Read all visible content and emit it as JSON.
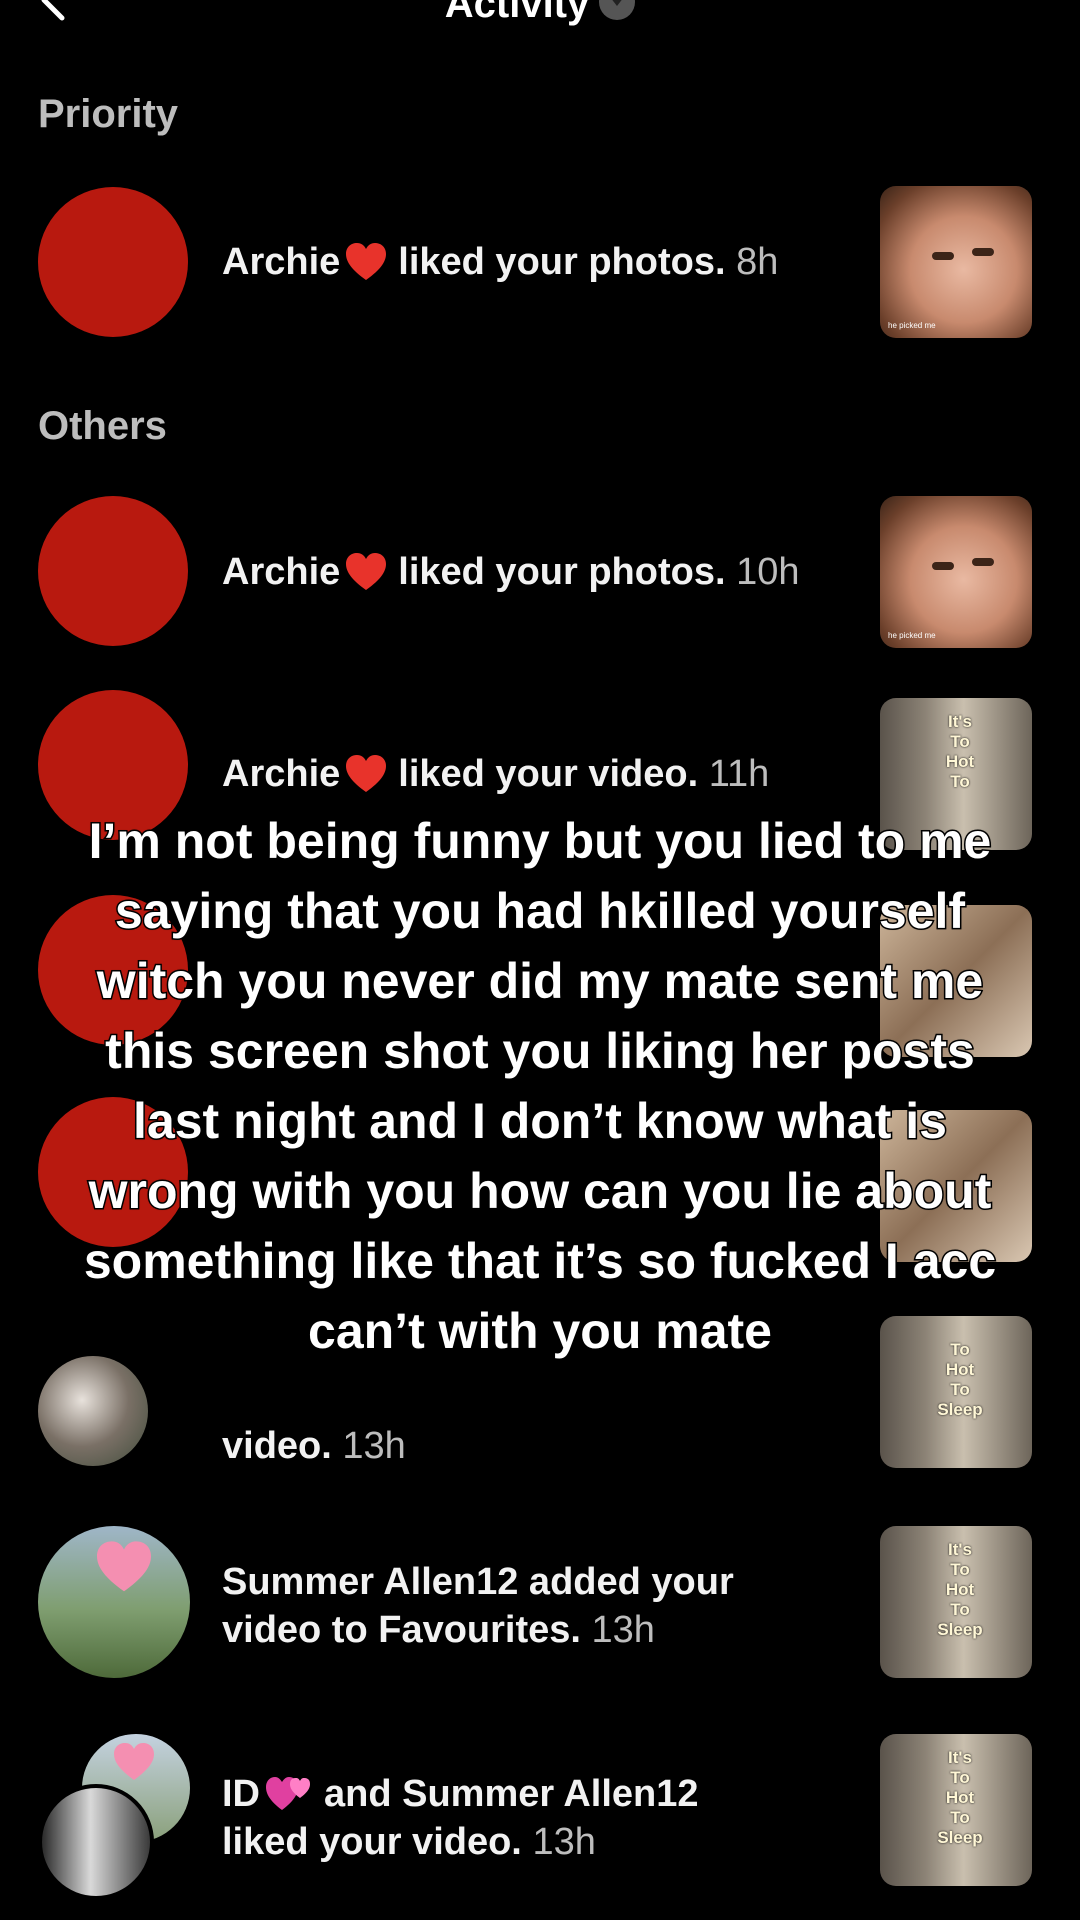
{
  "header": {
    "title": "Activity"
  },
  "sections": {
    "priority": "Priority",
    "others": "Others"
  },
  "rows": [
    {
      "name": "Archie",
      "action": "liked your photos.",
      "time": "8h",
      "thumb_caption": "he picked me"
    },
    {
      "name": "Archie",
      "action": "liked your photos.",
      "time": "10h",
      "thumb_caption": "he picked me"
    },
    {
      "name": "Archie",
      "action": "liked your video.",
      "time": "11h"
    },
    {
      "line2": "video.",
      "time": "13h"
    },
    {
      "text_line1": "Summer Allen12 added your",
      "text_line2": "video to Favourites.",
      "time": "13h"
    },
    {
      "name": "ID",
      "text_line1_rest": "and Summer Allen12",
      "text_line2": "liked your video.",
      "time": "13h"
    }
  ],
  "thumb_hot_text": [
    "It's",
    "To",
    "Hot",
    "To",
    "Sleep"
  ],
  "overlay_text": "I’m not being funny but you lied to me saying that you had hkilled yourself witch you never did my mate sent me this screen shot you liking her posts last night and I don’t know what is wrong with you how can you lie about something like that it’s so fucked I acc can’t with you mate"
}
